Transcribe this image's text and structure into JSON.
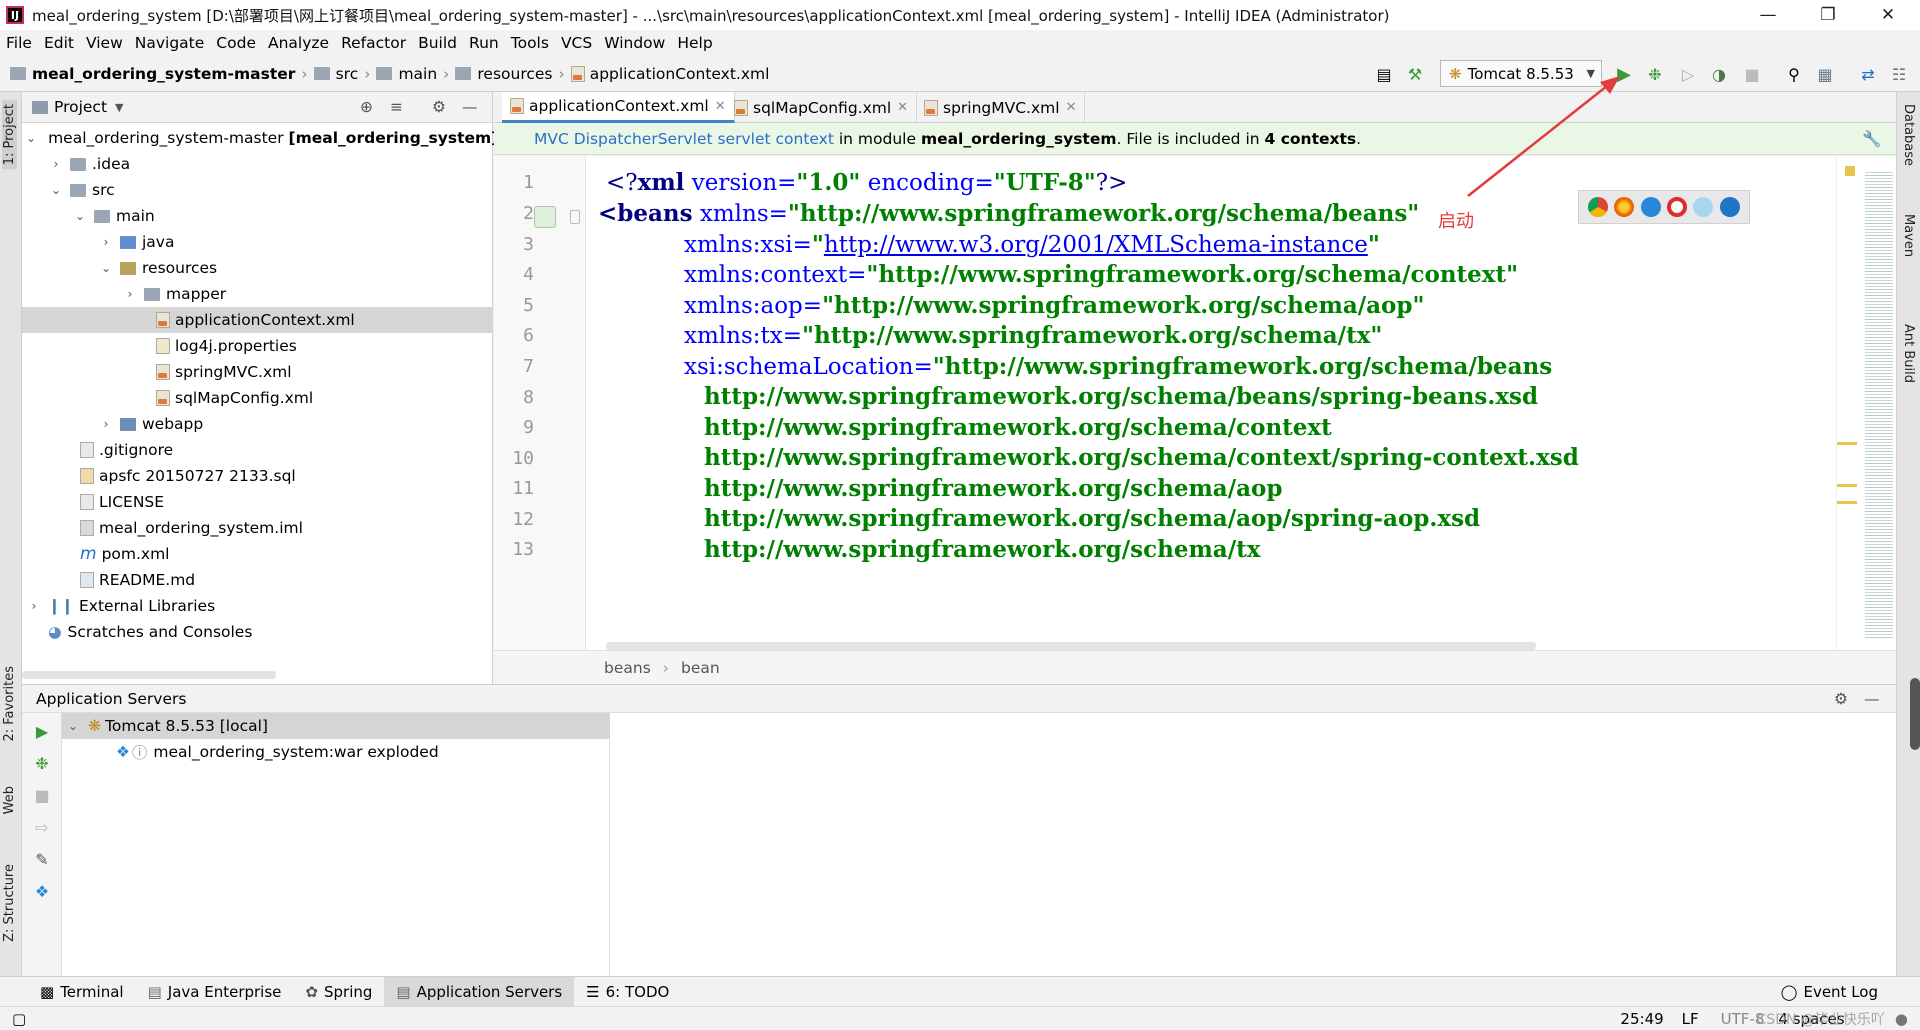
{
  "window": {
    "title": "meal_ordering_system [D:\\部署项目\\网上订餐项目\\meal_ordering_system-master] - ...\\src\\main\\resources\\applicationContext.xml [meal_ordering_system] - IntelliJ IDEA (Administrator)",
    "app_icon": "IJ"
  },
  "menu": [
    "File",
    "Edit",
    "View",
    "Navigate",
    "Code",
    "Analyze",
    "Refactor",
    "Build",
    "Run",
    "Tools",
    "VCS",
    "Window",
    "Help"
  ],
  "breadcrumb": [
    "meal_ordering_system-master",
    "src",
    "main",
    "resources",
    "applicationContext.xml"
  ],
  "run_config": "Tomcat 8.5.53",
  "left_tabs": {
    "project": "1: Project",
    "favorites": "2: Favorites",
    "web": "Web",
    "structure": "Z: Structure"
  },
  "right_tabs": {
    "database": "Database",
    "maven": "Maven",
    "ant": "Ant Build"
  },
  "project_panel": {
    "title": "Project",
    "tree": [
      {
        "label": "meal_ordering_system-master",
        "suffix": "[meal_ordering_system]"
      },
      {
        "label": ".idea"
      },
      {
        "label": "src"
      },
      {
        "label": "main"
      },
      {
        "label": "java"
      },
      {
        "label": "resources"
      },
      {
        "label": "mapper"
      },
      {
        "label": "applicationContext.xml"
      },
      {
        "label": "log4j.properties"
      },
      {
        "label": "springMVC.xml"
      },
      {
        "label": "sqlMapConfig.xml"
      },
      {
        "label": "webapp"
      },
      {
        "label": ".gitignore"
      },
      {
        "label": "apsfc 20150727 2133.sql"
      },
      {
        "label": "LICENSE"
      },
      {
        "label": "meal_ordering_system.iml"
      },
      {
        "label": "pom.xml"
      },
      {
        "label": "README.md"
      },
      {
        "label": "External Libraries"
      },
      {
        "label": "Scratches and Consoles"
      }
    ]
  },
  "editor": {
    "tabs": [
      "applicationContext.xml",
      "sqlMapConfig.xml",
      "springMVC.xml"
    ],
    "banner": {
      "link": "MVC DispatcherServlet servlet context",
      "text1": "in module",
      "module": "meal_ordering_system",
      "text2": ". File is included in",
      "count": "4 contexts",
      "text3": "."
    },
    "line_numbers": [
      "1",
      "2",
      "3",
      "4",
      "5",
      "6",
      "7",
      "8",
      "9",
      "10",
      "11",
      "12",
      "13"
    ],
    "lines": {
      "l1": {
        "open": "<?",
        "tag": "xml",
        "a1": " version=",
        "v1": "\"1.0\"",
        "a2": " encoding=",
        "v2": "\"UTF-8\"",
        "close": "?>"
      },
      "l2": {
        "tag": "<beans",
        "attr": " xmlns=",
        "val": "\"http://www.springframework.org/schema/beans\""
      },
      "l3": {
        "attr": "xmlns:xsi=",
        "q1": "\"",
        "val": "http://www.w3.org/2001/XMLSchema-instance",
        "q2": "\""
      },
      "l4": {
        "attr": "xmlns:context=",
        "val": "\"http://www.springframework.org/schema/context\""
      },
      "l5": {
        "attr": "xmlns:aop=",
        "val": "\"http://www.springframework.org/schema/aop\""
      },
      "l6": {
        "attr": "xmlns:tx=",
        "val": "\"http://www.springframework.org/schema/tx\""
      },
      "l7": {
        "attr": "xsi:schemaLocation=",
        "val": "\"http://www.springframework.org/schema/beans"
      },
      "l8": "http://www.springframework.org/schema/beans/spring-beans.xsd",
      "l9": "http://www.springframework.org/schema/context",
      "l10": "http://www.springframework.org/schema/context/spring-context.xsd",
      "l11": "http://www.springframework.org/schema/aop",
      "l12": "http://www.springframework.org/schema/aop/spring-aop.xsd",
      "l13": "http://www.springframework.org/schema/tx"
    },
    "breadcrumb": [
      "beans",
      "bean"
    ],
    "annotation": "启动"
  },
  "app_servers": {
    "title": "Application Servers",
    "server": "Tomcat 8.5.53 [local]",
    "artifact": "meal_ordering_system:war exploded"
  },
  "bottom_tabs": [
    "Terminal",
    "Java Enterprise",
    "Spring",
    "Application Servers",
    "6: TODO"
  ],
  "event_log": "Event Log",
  "status": {
    "position": "25:49",
    "line_sep": "LF",
    "encoding": "UTF-8",
    "indent": "4 spaces",
    "watermark": "CSDN @毕业快乐吖"
  },
  "colors": {
    "accent": "#4083c9",
    "run_green": "#3a9b3a",
    "annotation_red": "#e23b3b",
    "banner_bg": "#eaf7e6"
  }
}
